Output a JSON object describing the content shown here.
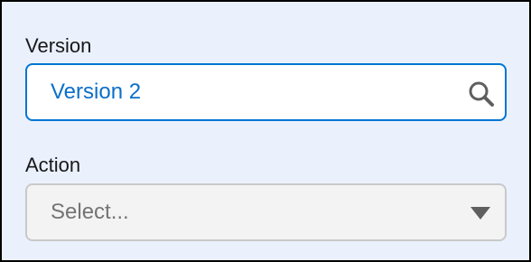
{
  "version_field": {
    "label": "Version",
    "value": "Version 2",
    "icon": "search-icon"
  },
  "action_field": {
    "label": "Action",
    "placeholder": "Select...",
    "icon": "caret-down-icon"
  },
  "colors": {
    "background": "#eaf1fd",
    "accent": "#0176d3",
    "value_text": "#0b6fc9",
    "disabled_bg": "#f3f3f3",
    "disabled_border": "#c9c9c9"
  }
}
